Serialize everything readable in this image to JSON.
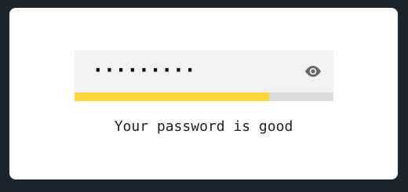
{
  "password_field": {
    "masked_value": "·········",
    "toggle_icon": "eye-icon"
  },
  "strength": {
    "level": 0.75,
    "fill_color": "#fdd835",
    "track_color": "#dcdcdc"
  },
  "message": "Your password is good"
}
